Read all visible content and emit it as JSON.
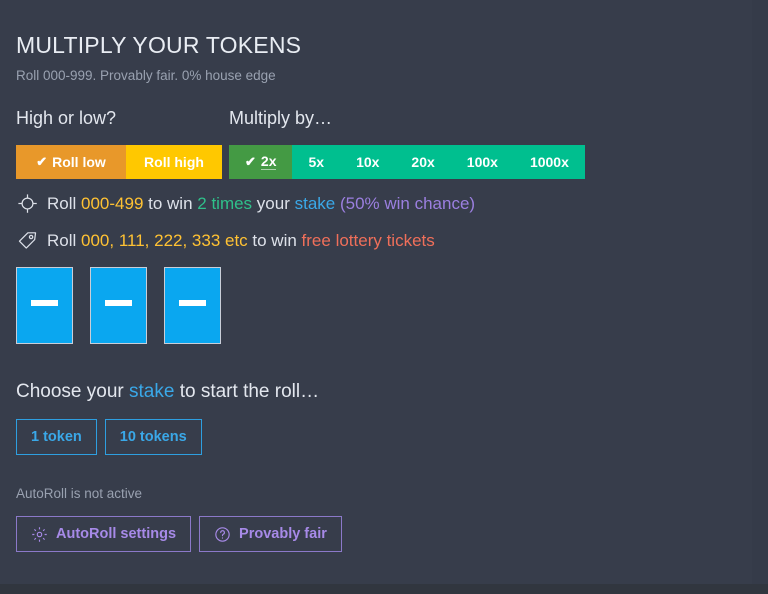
{
  "header": {
    "title": "MULTIPLY YOUR TOKENS",
    "subtitle": "Roll 000-999. Provably fair. 0% house edge"
  },
  "direction": {
    "label": "High or low?",
    "options": [
      {
        "label": "Roll low",
        "selected": true,
        "color": "#e8982a"
      },
      {
        "label": "Roll high",
        "selected": false,
        "color": "#ffc800"
      }
    ]
  },
  "multiplier": {
    "label": "Multiply by…",
    "options": [
      {
        "label": "2x",
        "selected": true
      },
      {
        "label": "5x",
        "selected": false
      },
      {
        "label": "10x",
        "selected": false
      },
      {
        "label": "20x",
        "selected": false
      },
      {
        "label": "100x",
        "selected": false
      },
      {
        "label": "1000x",
        "selected": false
      }
    ],
    "selected_color": "#449a44",
    "unselected_color": "#00bf8f"
  },
  "info": {
    "line1": {
      "icon": "crosshair-icon",
      "prefix": "Roll ",
      "range": "000-499",
      "mid": " to win ",
      "times": "2 times",
      "your": " your ",
      "stake": "stake",
      "chance": " (50% win chance)"
    },
    "line2": {
      "icon": "tag-icon",
      "prefix": "Roll ",
      "numbers": "000, 111, 222, 333 etc",
      "mid": " to win ",
      "prize": "free lottery tickets"
    }
  },
  "dice": [
    {
      "value": "—"
    },
    {
      "value": "—"
    },
    {
      "value": "—"
    }
  ],
  "stake": {
    "heading_prefix": "Choose your ",
    "heading_link": "stake",
    "heading_suffix": " to start the roll…",
    "buttons": [
      {
        "label": "1 token"
      },
      {
        "label": "10 tokens"
      }
    ]
  },
  "footer": {
    "status": "AutoRoll is not active",
    "buttons": [
      {
        "label": "AutoRoll settings",
        "icon": "gear-icon"
      },
      {
        "label": "Provably fair",
        "icon": "question-circle-icon"
      }
    ]
  },
  "colors": {
    "background": "#373d4b",
    "page": "#353b49",
    "blue": "#0aa7f0",
    "purple": "#a78ae8",
    "yellow": "#ffc233",
    "green": "#2fc08a",
    "salmon": "#ef6f5a"
  }
}
